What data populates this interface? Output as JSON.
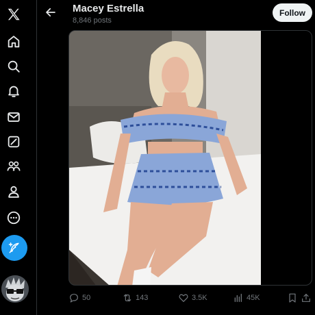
{
  "header": {
    "title": "Macey Estrella",
    "post_count": "8,846 posts",
    "follow_label": "Follow"
  },
  "nav": {
    "items": [
      {
        "name": "x-logo-icon"
      },
      {
        "name": "home-icon"
      },
      {
        "name": "search-icon"
      },
      {
        "name": "notifications-icon"
      },
      {
        "name": "messages-icon"
      },
      {
        "name": "grok-icon"
      },
      {
        "name": "communities-icon"
      },
      {
        "name": "profile-icon"
      },
      {
        "name": "more-icon"
      }
    ],
    "compose_icon": "feather-plus-icon"
  },
  "media": {
    "description_visible": false
  },
  "actions": {
    "replies": "50",
    "reposts": "143",
    "likes": "3.5K",
    "views": "45K"
  },
  "colors": {
    "accent": "#1d9bf0",
    "text": "#e7e9ea",
    "muted": "#71767b",
    "border": "#2f3336",
    "background": "#000000"
  }
}
